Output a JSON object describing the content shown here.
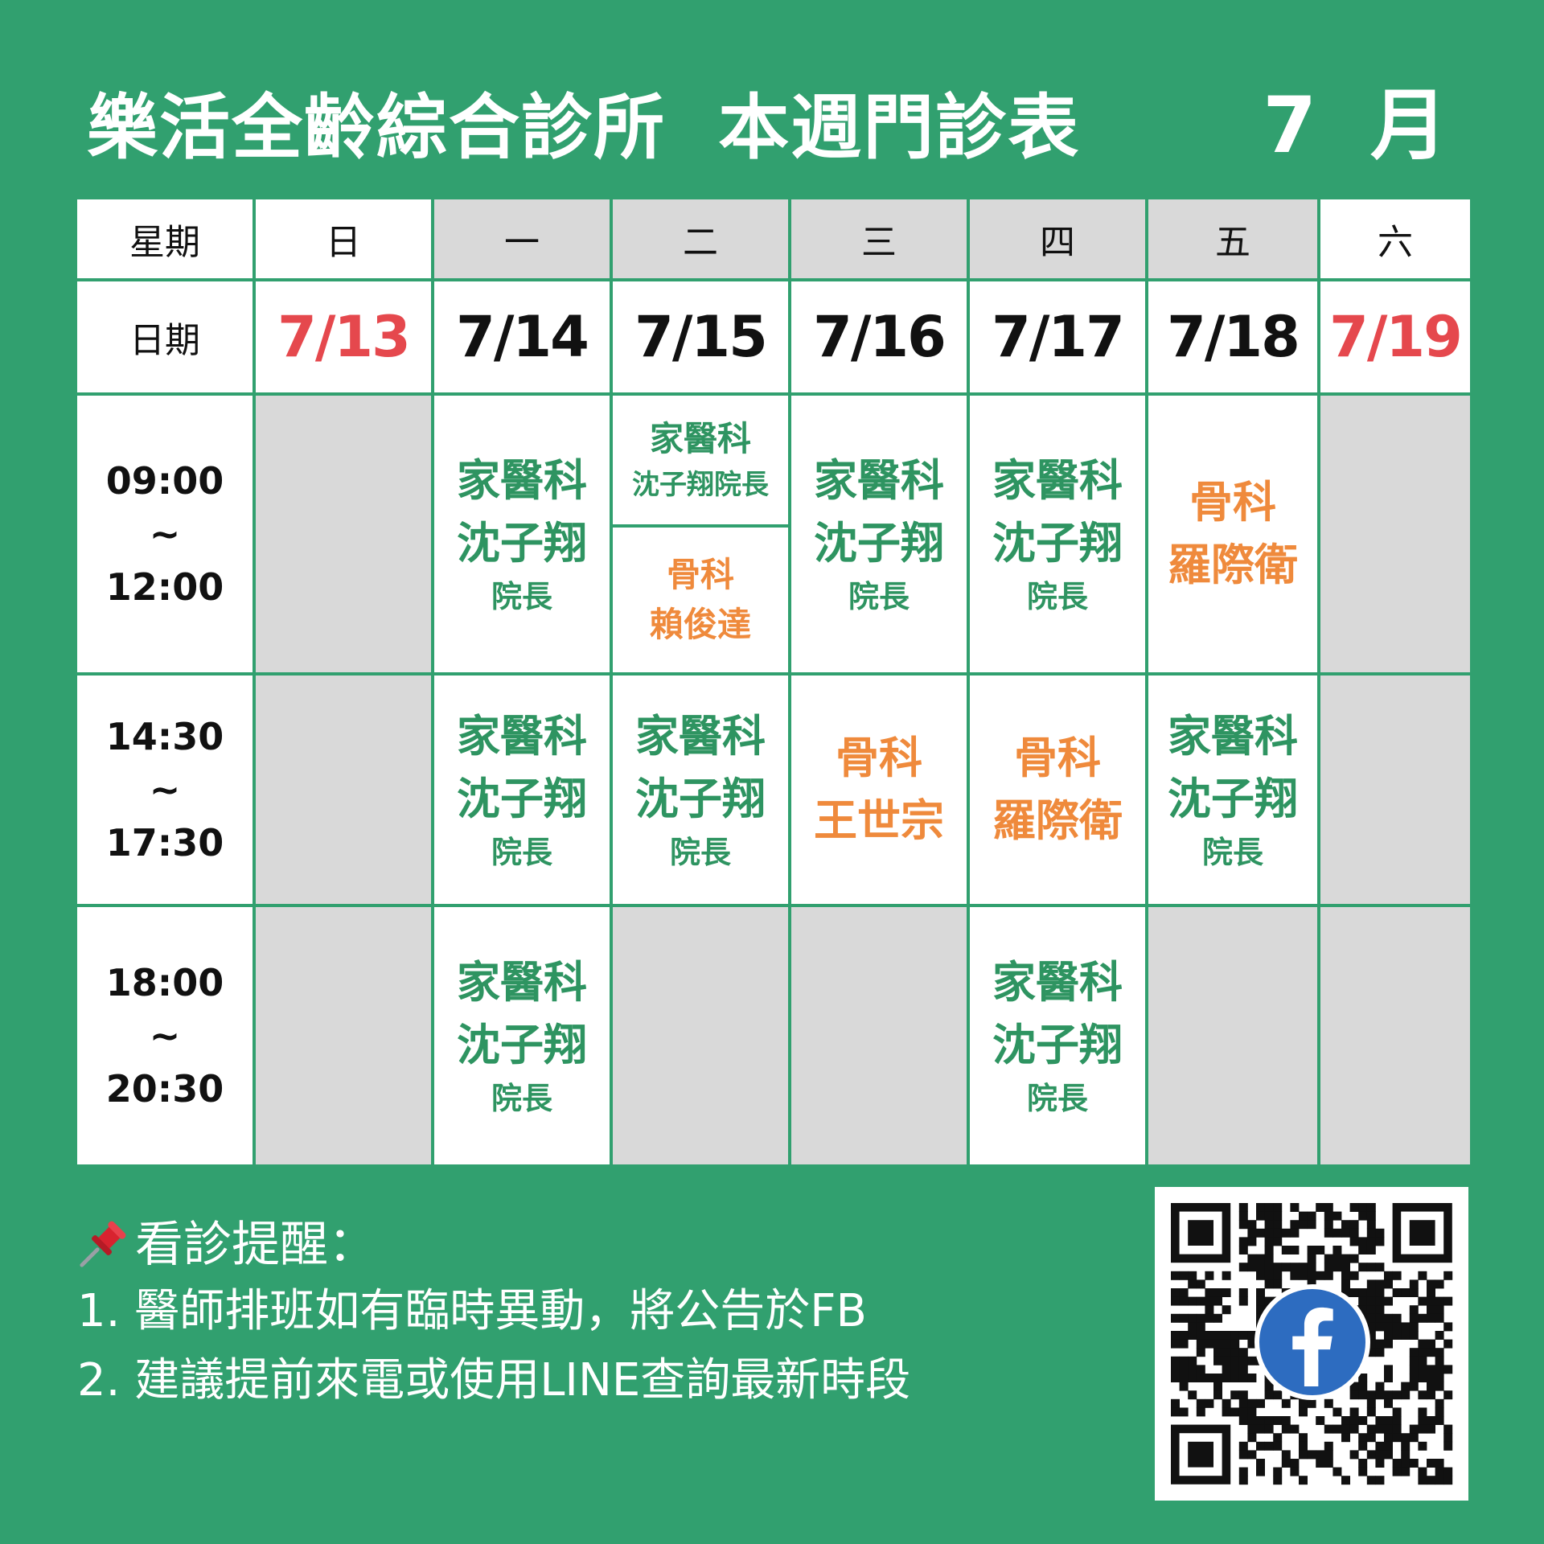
{
  "header": {
    "title": "樂活全齡綜合診所  本週門診表",
    "month": "7  月"
  },
  "table": {
    "week_label": "星期",
    "date_label": "日期",
    "weekdays": [
      "日",
      "一",
      "二",
      "三",
      "四",
      "五",
      "六"
    ],
    "dates": [
      "7/13",
      "7/14",
      "7/15",
      "7/16",
      "7/17",
      "7/18",
      "7/19"
    ],
    "slots": [
      {
        "start": "09:00",
        "sep": "~",
        "end": "12:00"
      },
      {
        "start": "14:30",
        "sep": "~",
        "end": "17:30"
      },
      {
        "start": "18:00",
        "sep": "~",
        "end": "20:30"
      }
    ],
    "am": {
      "mon": {
        "dept": "家醫科",
        "doctor": "沈子翔",
        "title": "院長"
      },
      "tue_top": {
        "dept": "家醫科",
        "doctor": "沈子翔院長"
      },
      "tue_bottom": {
        "dept": "骨科",
        "doctor": "賴俊達"
      },
      "wed": {
        "dept": "家醫科",
        "doctor": "沈子翔",
        "title": "院長"
      },
      "thu": {
        "dept": "家醫科",
        "doctor": "沈子翔",
        "title": "院長"
      },
      "fri": {
        "dept": "骨科",
        "doctor": "羅際衛"
      }
    },
    "pm": {
      "mon": {
        "dept": "家醫科",
        "doctor": "沈子翔",
        "title": "院長"
      },
      "tue": {
        "dept": "家醫科",
        "doctor": "沈子翔",
        "title": "院長"
      },
      "wed": {
        "dept": "骨科",
        "doctor": "王世宗"
      },
      "thu": {
        "dept": "骨科",
        "doctor": "羅際衛"
      },
      "fri": {
        "dept": "家醫科",
        "doctor": "沈子翔",
        "title": "院長"
      }
    },
    "ev": {
      "mon": {
        "dept": "家醫科",
        "doctor": "沈子翔",
        "title": "院長"
      },
      "thu": {
        "dept": "家醫科",
        "doctor": "沈子翔",
        "title": "院長"
      }
    }
  },
  "notes": {
    "heading": "看診提醒：",
    "items": [
      "1. 醫師排班如有臨時異動，將公告於FB",
      "2. 建議提前來電或使用LINE查詢最新時段"
    ]
  },
  "icons": {
    "pin": "pushpin-icon",
    "facebook": "facebook-icon"
  },
  "colors": {
    "background": "#31a06f",
    "family_medicine": "#2e9461",
    "orthopedics": "#ef8a3c",
    "weekend": "#e5484d",
    "closed": "#d9d9d9"
  }
}
